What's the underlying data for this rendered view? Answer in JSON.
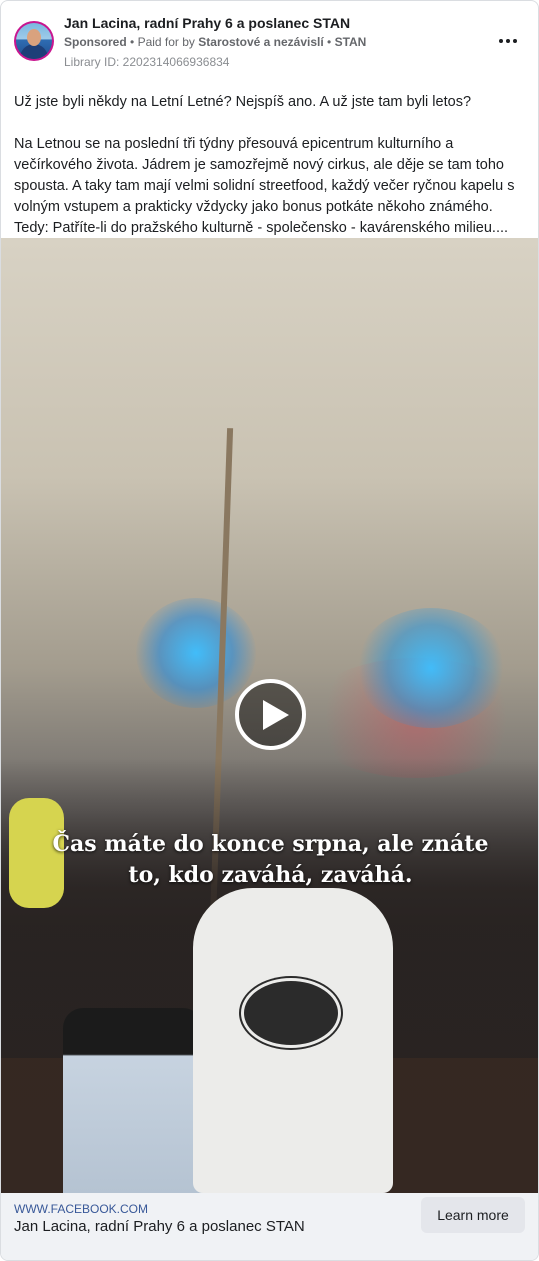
{
  "post": {
    "page_name": "Jan Lacina, radní Prahy 6 a poslanec STAN",
    "sponsored_label": "Sponsored",
    "separator": "•",
    "paid_for_prefix": "Paid for by",
    "payer": "Starostové a nezávislí",
    "payer_short": "STAN",
    "library_id": "Library ID: 2202314066936834",
    "body": {
      "paragraph_1": "Už jste byli někdy na Letní Letné? Nejspíš ano. A už jste tam byli letos?",
      "paragraph_2": "Na Letnou se na poslední tři týdny přesouvá epicentrum kulturního a večírkového života. Jádrem je samozřejmě nový cirkus, ale děje se tam toho spousta. A taky tam mají velmi solidní streetfood, každý večer ryčnou kapelu s volným vstupem a prakticky vždycky jako bonus potkáte někoho známého. Tedy: Patříte-li do pražského kulturně - společensko - kavárenského milieu...."
    },
    "video": {
      "caption_line_1": "Čas máte do konce srpna, ale znáte",
      "caption_line_2": "to, kdo zaváhá, zaváhá."
    },
    "footer": {
      "domain": "WWW.FACEBOOK.COM",
      "title": "Jan Lacina, radní Prahy 6 a poslanec STAN",
      "cta_label": "Learn more"
    }
  },
  "icons": {
    "more": "more-horizontal-icon",
    "play": "play-icon"
  },
  "colors": {
    "avatar_ring": "#c8168f",
    "link": "#385898",
    "footer_bg": "#f0f2f5",
    "cta_bg": "#e4e6eb"
  }
}
